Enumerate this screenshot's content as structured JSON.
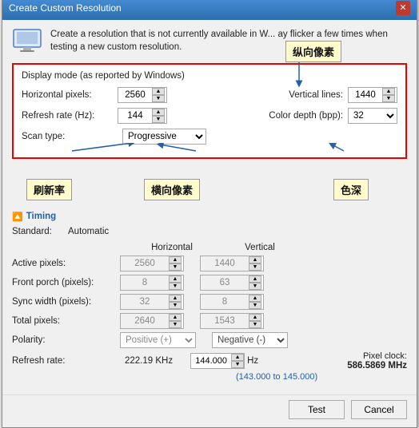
{
  "dialog": {
    "title": "Create Custom Resolution",
    "close_btn": "✕"
  },
  "intro": {
    "text": "Create a resolution that is not currently available in W... ay flicker a few times when testing a new custom resolution."
  },
  "display_mode": {
    "section_label": "Display mode (as reported by Windows)",
    "horizontal_pixels_label": "Horizontal pixels:",
    "horizontal_pixels_value": "2560",
    "refresh_rate_label": "Refresh rate (Hz):",
    "refresh_rate_value": "144",
    "scan_type_label": "Scan type:",
    "scan_type_value": "Progressive",
    "vertical_lines_label": "Vertical lines:",
    "vertical_lines_value": "1440",
    "color_depth_label": "Color depth (bpp):",
    "color_depth_value": "32"
  },
  "callouts": {
    "vertical_pixels": "纵向像素",
    "refresh_rate": "刷新率",
    "horizontal_pixels": "横向像素",
    "color_depth": "色深"
  },
  "timing": {
    "section_label": "Timing",
    "standard_label": "Standard:",
    "standard_value": "Automatic",
    "horizontal_label": "Horizontal",
    "vertical_label": "Vertical",
    "active_pixels_label": "Active pixels:",
    "active_h": "2560",
    "active_v": "1440",
    "front_porch_label": "Front porch (pixels):",
    "front_porch_h": "8",
    "front_porch_v": "63",
    "sync_width_label": "Sync width (pixels):",
    "sync_width_h": "32",
    "sync_width_v": "8",
    "total_pixels_label": "Total pixels:",
    "total_h": "2640",
    "total_v": "1543",
    "polarity_label": "Polarity:",
    "polarity_h": "Positive (+)",
    "polarity_v": "Negative (-)",
    "refresh_rate_label": "Refresh rate:",
    "refresh_rate_value": "222.19 KHz",
    "hz_value": "144.000",
    "hz_unit": "Hz",
    "range_text": "(143.000 to 145.000)",
    "pixel_clock_label": "Pixel clock:",
    "pixel_clock_value": "586.5869 MHz"
  },
  "footer": {
    "test_label": "Test",
    "cancel_label": "Cancel"
  }
}
